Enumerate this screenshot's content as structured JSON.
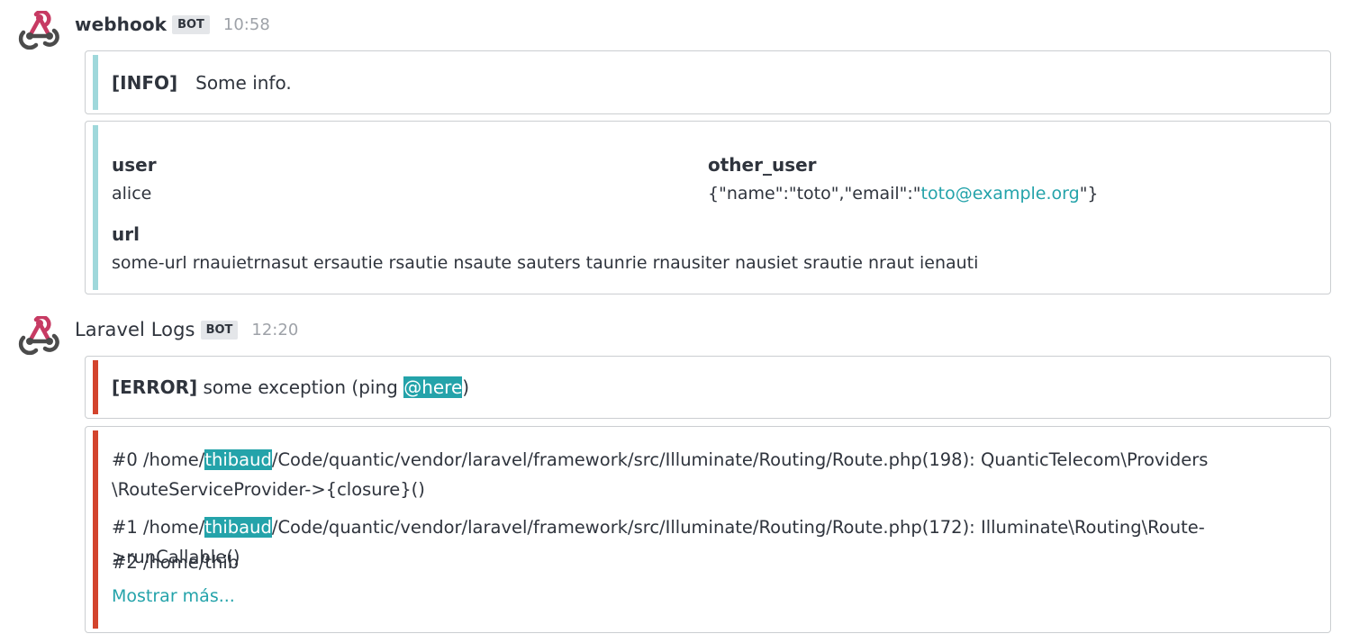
{
  "colors": {
    "info_bar": "#9fd8db",
    "error_bar": "#d3442d",
    "accent": "#24a3aa",
    "bot_badge_bg": "#e4e6e9"
  },
  "messages": [
    {
      "author": "webhook",
      "badge": "BOT",
      "time": "10:58",
      "avatar_icon": "webhook-icon",
      "info": {
        "level": "[INFO]",
        "text": "Some info."
      },
      "fields": [
        {
          "title": "user",
          "value": "alice"
        },
        {
          "title": "other_user",
          "value_prefix": "{\"name\":\"toto\",\"email\":\"",
          "value_link": "toto@example.org",
          "value_suffix": "\"}"
        },
        {
          "title": "url",
          "value": "some-url rnauietrnasut ersautie rsautie nsaute sauters taunrie rnausiter nausiet srautie nraut ienauti"
        }
      ]
    },
    {
      "author": "Laravel Logs",
      "badge": "BOT",
      "time": "12:20",
      "avatar_icon": "webhook-icon",
      "error": {
        "level": "[ERROR]",
        "text": "some exception (ping ",
        "mention": "@here",
        "close": ")"
      },
      "trace": {
        "line0_a": "#0 /home/",
        "line0_hl": "thibaud",
        "line0_b": "/Code/quantic/vendor/laravel/framework/src/Illuminate/Routing/Route.php(198): QuanticTelecom\\Providers",
        "line0_c": "\\RouteServiceProvider->{closure}()",
        "line1_a": "#1 /home/",
        "line1_hl": "thibaud",
        "line1_b": "/Code/quantic/vendor/laravel/framework/src/Illuminate/Routing/Route.php(172): Illuminate\\Routing\\Route->runCallable()",
        "line2": "#2 /home/thib",
        "show_more": "Mostrar más..."
      }
    }
  ]
}
